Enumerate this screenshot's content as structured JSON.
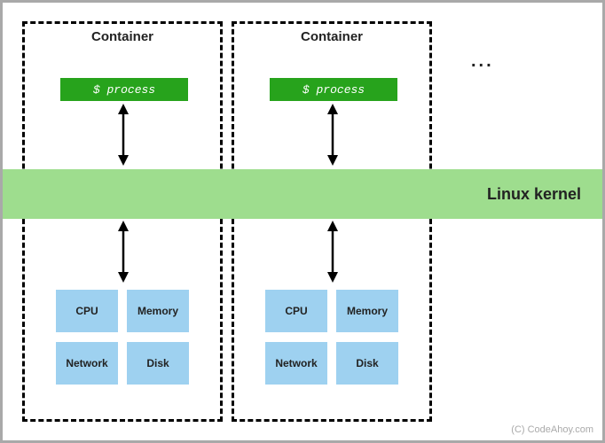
{
  "containers": [
    {
      "title": "Container",
      "process": "$ process",
      "resources": [
        "CPU",
        "Memory",
        "Network",
        "Disk"
      ]
    },
    {
      "title": "Container",
      "process": "$ process",
      "resources": [
        "CPU",
        "Memory",
        "Network",
        "Disk"
      ]
    }
  ],
  "kernel_label": "Linux kernel",
  "ellipsis": "...",
  "credit": "(C) CodeAhoy.com",
  "colors": {
    "process_bg": "#27a31c",
    "kernel_bg": "#9edd8e",
    "resource_bg": "#9ed1f0",
    "canvas_border": "#a9a9a9"
  }
}
